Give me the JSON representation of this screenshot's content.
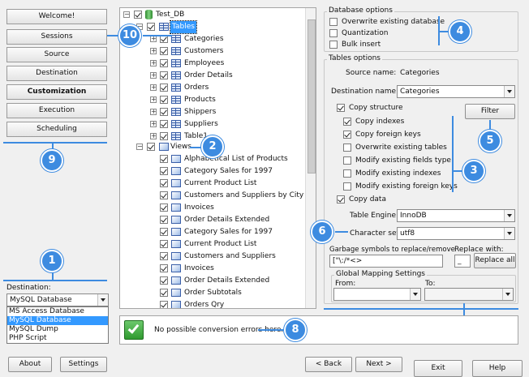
{
  "nav": {
    "items": [
      {
        "label": "Welcome!"
      },
      {
        "label": "Sessions"
      },
      {
        "label": "Source"
      },
      {
        "label": "Destination"
      },
      {
        "label": "Customization"
      },
      {
        "label": "Execution"
      },
      {
        "label": "Scheduling"
      }
    ],
    "active": "Customization"
  },
  "destination": {
    "label": "Destination:",
    "selected": "MySQL Database",
    "options": [
      "MS Access Database",
      "MySQL Database",
      "MySQL Dump",
      "PHP Script"
    ]
  },
  "tree": {
    "root": "Test_DB",
    "tables_label": "Tables",
    "tables": [
      "Categories",
      "Customers",
      "Employees",
      "Order Details",
      "Orders",
      "Products",
      "Shippers",
      "Suppliers",
      "Table1"
    ],
    "views_label": "Views",
    "views": [
      "Alphabetical List of Products",
      "Category Sales for 1997",
      "Current Product List",
      "Customers and Suppliers by City",
      "Invoices",
      "Order Details Extended",
      "Category Sales for 1997",
      "Current Product List",
      "Customers and Suppliers",
      "Invoices",
      "Order Details Extended",
      "Order Subtotals",
      "Orders Qry"
    ]
  },
  "database_options": {
    "title": "Database options",
    "items": [
      {
        "label": "Overwrite existing database",
        "checked": false
      },
      {
        "label": "Quantization",
        "checked": false
      },
      {
        "label": "Bulk insert",
        "checked": false
      }
    ]
  },
  "tables_options": {
    "title": "Tables options",
    "source_name_label": "Source name:",
    "source_name": "Categories",
    "destination_name_label": "Destination name:",
    "destination_name": "Categories",
    "filter_label": "Filter",
    "checks": [
      {
        "label": "Copy structure",
        "checked": true
      },
      {
        "label": "Copy indexes",
        "checked": true
      },
      {
        "label": "Copy foreign keys",
        "checked": true
      },
      {
        "label": "Overwrite existing tables",
        "checked": false
      },
      {
        "label": "Modify existing fields type",
        "checked": false
      },
      {
        "label": "Modify existing indexes",
        "checked": false
      },
      {
        "label": "Modify existing foreign keys",
        "checked": false
      },
      {
        "label": "Copy data",
        "checked": true
      }
    ],
    "table_engine_label": "Table Engine:",
    "table_engine": "InnoDB",
    "charset_label": "Character set:",
    "charset": "utf8",
    "garbage_label": "Garbage symbols to replace/remove",
    "garbage_value": "[\"\\:/*<>",
    "replace_with_label": "Replace with:",
    "replace_with_value": "_",
    "replace_all_label": "Replace all"
  },
  "global_mapping": {
    "title": "Global Mapping Settings",
    "from_label": "From:",
    "to_label": "To:"
  },
  "status": {
    "message": "No possible conversion errors here."
  },
  "bottom": {
    "about": "About",
    "settings": "Settings",
    "back": "< Back",
    "next": "Next >",
    "exit": "Exit",
    "help": "Help"
  },
  "badges": [
    "1",
    "2",
    "3",
    "4",
    "5",
    "6",
    "8",
    "9",
    "10"
  ],
  "colors": {
    "badge": "#3d8be0",
    "selection": "#3399ff"
  }
}
